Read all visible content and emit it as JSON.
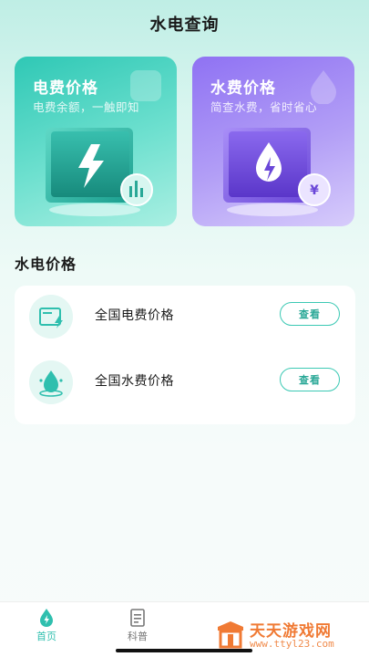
{
  "header": {
    "title": "水电查询"
  },
  "cards": [
    {
      "title": "电费价格",
      "subtitle": "电费余额，一触即知",
      "icon": "lightning-icon"
    },
    {
      "title": "水费价格",
      "subtitle": "简查水费，省时省心",
      "icon": "water-drop-icon"
    }
  ],
  "section": {
    "title": "水电价格"
  },
  "list": [
    {
      "label": "全国电费价格",
      "button": "查看",
      "icon": "electric-bill-icon"
    },
    {
      "label": "全国水费价格",
      "button": "查看",
      "icon": "water-drop-icon"
    }
  ],
  "tabbar": {
    "items": [
      {
        "label": "首页",
        "icon": "home-drop-icon",
        "active": true
      },
      {
        "label": "科普",
        "icon": "document-icon",
        "active": false
      }
    ]
  },
  "watermark": {
    "name": "天天游戏网",
    "url": "www.ttyl23.com"
  },
  "colors": {
    "accent": "#2fbfae",
    "electric_card": "#2fc8b5",
    "water_card": "#8f72f3",
    "watermark": "#f07a34"
  }
}
